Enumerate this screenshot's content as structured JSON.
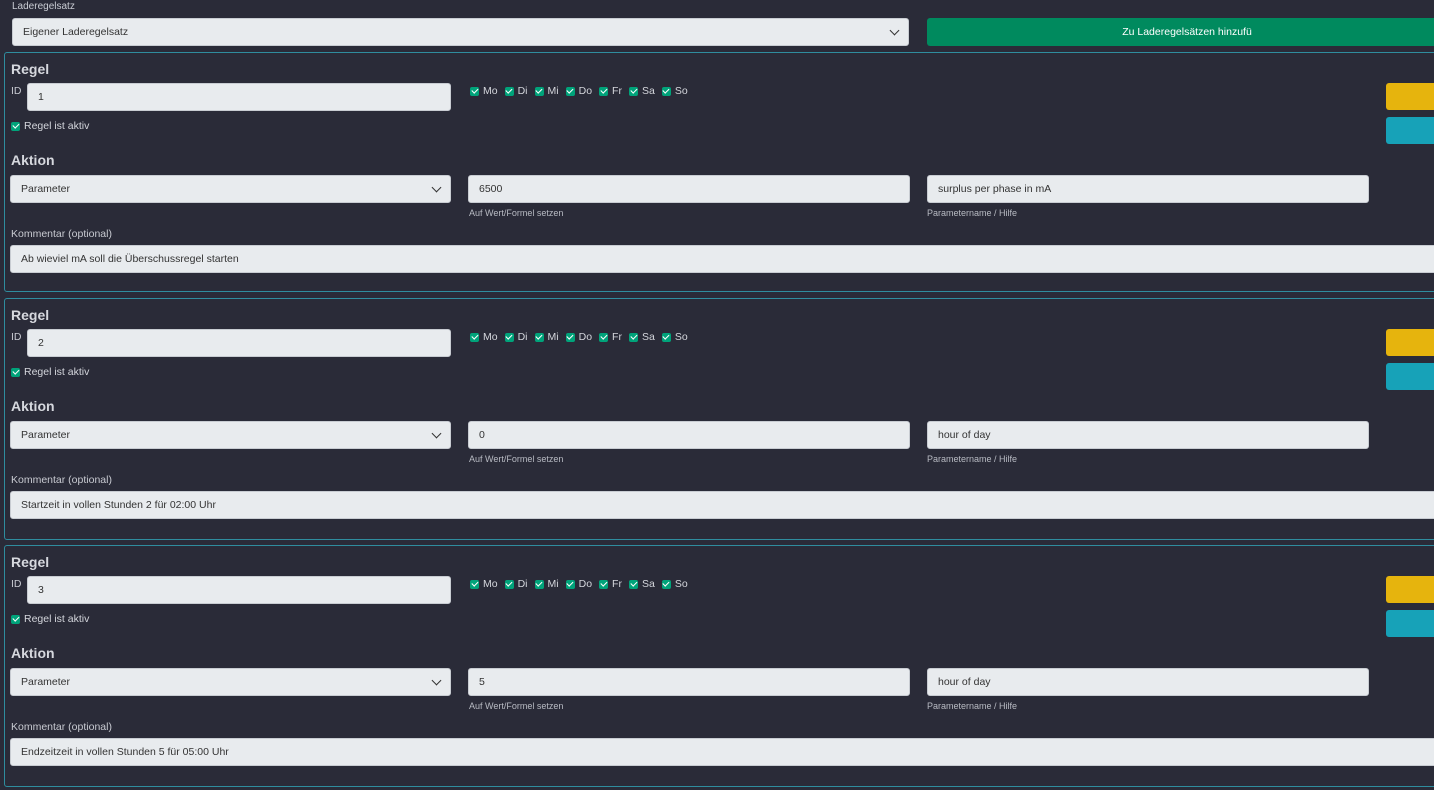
{
  "header": {
    "label": "Laderegelsatz",
    "select_value": "Eigener Laderegelsatz",
    "add_button": "Zu Laderegelsätzen hinzufü"
  },
  "colors": {
    "accent_green": "#008a5e",
    "warning": "#e6b40d",
    "info": "#17a2b8",
    "border": "#2f8d9e"
  },
  "rules": [
    {
      "title": "Regel",
      "id_label": "ID",
      "id": "1",
      "days": [
        "Mo",
        "Di",
        "Mi",
        "Do",
        "Fr",
        "Sa",
        "So"
      ],
      "active_label": "Regel ist aktiv",
      "action_title": "Aktion",
      "type": "Parameter",
      "value": "6500",
      "value_hint": "Auf Wert/Formel setzen",
      "param": "surplus per phase in mA",
      "param_hint": "Parametername / Hilfe",
      "comment_label": "Kommentar (optional)",
      "comment": "Ab wieviel mA soll die Überschussregel starten"
    },
    {
      "title": "Regel",
      "id_label": "ID",
      "id": "2",
      "days": [
        "Mo",
        "Di",
        "Mi",
        "Do",
        "Fr",
        "Sa",
        "So"
      ],
      "active_label": "Regel ist aktiv",
      "action_title": "Aktion",
      "type": "Parameter",
      "value": "0",
      "value_hint": "Auf Wert/Formel setzen",
      "param": "hour of day",
      "param_hint": "Parametername / Hilfe",
      "comment_label": "Kommentar (optional)",
      "comment": "Startzeit in vollen Stunden 2 für 02:00 Uhr"
    },
    {
      "title": "Regel",
      "id_label": "ID",
      "id": "3",
      "days": [
        "Mo",
        "Di",
        "Mi",
        "Do",
        "Fr",
        "Sa",
        "So"
      ],
      "active_label": "Regel ist aktiv",
      "action_title": "Aktion",
      "type": "Parameter",
      "value": "5",
      "value_hint": "Auf Wert/Formel setzen",
      "param": "hour of day",
      "param_hint": "Parametername / Hilfe",
      "comment_label": "Kommentar (optional)",
      "comment": "Endzeitzeit in vollen Stunden 5 für 05:00 Uhr"
    }
  ]
}
